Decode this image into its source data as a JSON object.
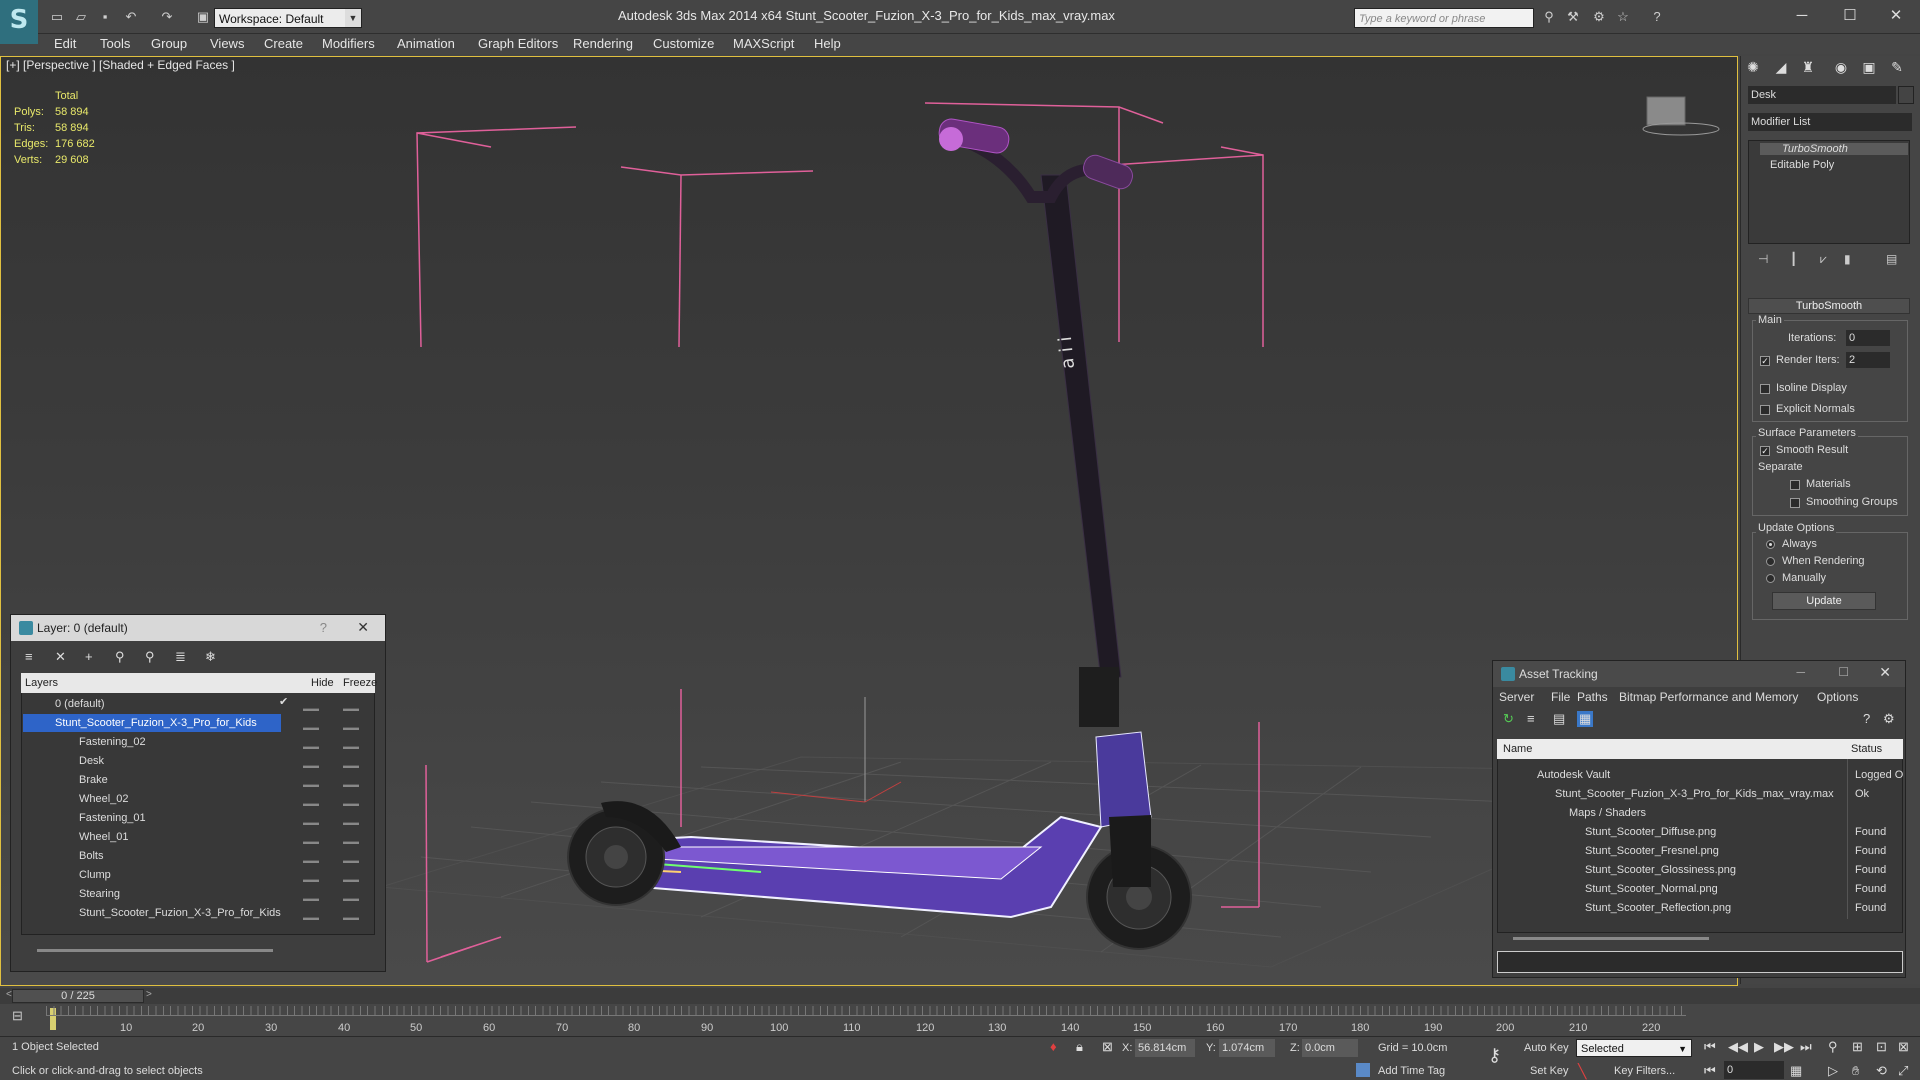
{
  "titlebar": {
    "title": "Autodesk 3ds Max  2014 x64     Stunt_Scooter_Fuzion_X-3_Pro_for_Kids_max_vray.max",
    "workspace": "Workspace: Default",
    "search_placeholder": "Type a keyword or phrase",
    "minimize": "─",
    "maximize": "☐",
    "close": "✕"
  },
  "menu": [
    "Edit",
    "Tools",
    "Group",
    "Views",
    "Create",
    "Modifiers",
    "Animation",
    "Graph Editors",
    "Rendering",
    "Customize",
    "MAXScript",
    "Help"
  ],
  "viewport": {
    "label": "[+] [Perspective ] [Shaded + Edged Faces ]",
    "stats_header": "Total",
    "stats": [
      {
        "k": "Polys:",
        "v": "58 894"
      },
      {
        "k": "Tris:",
        "v": "58 894"
      },
      {
        "k": "Edges:",
        "v": "176 682"
      },
      {
        "k": "Verts:",
        "v": "29 608"
      }
    ]
  },
  "command_panel": {
    "object_name": "Desk",
    "modifier_list": "Modifier List",
    "stack": [
      "TurboSmooth",
      "Editable Poly"
    ],
    "rollout_title": "TurboSmooth",
    "main_label": "Main",
    "iterations_label": "Iterations:",
    "iterations_value": "0",
    "render_iters_label": "Render Iters:",
    "render_iters_value": "2",
    "isoline": "Isoline Display",
    "explicit_normals": "Explicit Normals",
    "surface_params": "Surface Parameters",
    "smooth_result": "Smooth Result",
    "separate": "Separate",
    "materials": "Materials",
    "smoothing_groups": "Smoothing Groups",
    "update_options": "Update Options",
    "always": "Always",
    "when_rendering": "When Rendering",
    "manually": "Manually",
    "update_button": "Update"
  },
  "layer_panel": {
    "title": "Layer: 0 (default)",
    "help": "?",
    "close": "✕",
    "col_layers": "Layers",
    "col_hide": "Hide",
    "col_freeze": "Freeze",
    "rows": [
      "0 (default)",
      "Stunt_Scooter_Fuzion_X-3_Pro_for_Kids",
      "Fastening_02",
      "Desk",
      "Brake",
      "Wheel_02",
      "Fastening_01",
      "Wheel_01",
      "Bolts",
      "Clump",
      "Stearing",
      "Stunt_Scooter_Fuzion_X-3_Pro_for_Kids"
    ],
    "dash": "▬▬"
  },
  "asset_panel": {
    "title": "Asset Tracking",
    "menu": [
      "Server",
      "File",
      "Paths",
      "Bitmap Performance and Memory",
      "Options"
    ],
    "col_name": "Name",
    "col_status": "Status",
    "rows": [
      {
        "name": "Autodesk Vault",
        "status": "Logged O"
      },
      {
        "name": "Stunt_Scooter_Fuzion_X-3_Pro_for_Kids_max_vray.max",
        "status": "Ok"
      },
      {
        "name": "Maps / Shaders",
        "status": ""
      },
      {
        "name": "Stunt_Scooter_Diffuse.png",
        "status": "Found"
      },
      {
        "name": "Stunt_Scooter_Fresnel.png",
        "status": "Found"
      },
      {
        "name": "Stunt_Scooter_Glossiness.png",
        "status": "Found"
      },
      {
        "name": "Stunt_Scooter_Normal.png",
        "status": "Found"
      },
      {
        "name": "Stunt_Scooter_Reflection.png",
        "status": "Found"
      }
    ]
  },
  "timeline": {
    "frame": "0 / 225",
    "ticks": [
      "10",
      "20",
      "30",
      "40",
      "50",
      "60",
      "70",
      "80",
      "90",
      "100",
      "110",
      "120",
      "130",
      "140",
      "150",
      "160",
      "170",
      "180",
      "190",
      "200",
      "210",
      "220"
    ]
  },
  "status": {
    "selected": "1 Object Selected",
    "hint": "Click or click-and-drag to select objects",
    "x_label": "X:",
    "x_value": "56.814cm",
    "y_label": "Y:",
    "y_value": "1.074cm",
    "z_label": "Z:",
    "z_value": "0.0cm",
    "grid": "Grid = 10.0cm",
    "add_time_tag": "Add Time Tag",
    "auto_key": "Auto Key",
    "set_key": "Set Key",
    "selected_dropdown": "Selected",
    "key_filters": "Key Filters...",
    "frame_field": "0"
  }
}
